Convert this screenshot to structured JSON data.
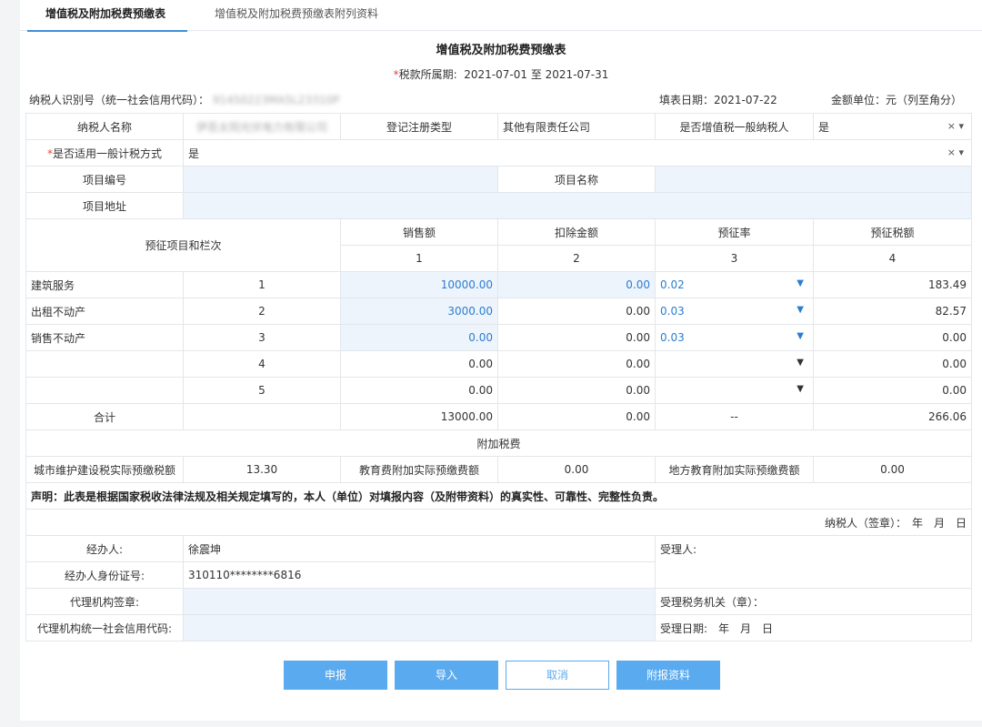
{
  "tabs": [
    "增值税及附加税费预缴表",
    "增值税及附加税费预缴表附列资料"
  ],
  "form": {
    "title": "增值税及附加税费预缴表",
    "period_star": "*",
    "period_label": "税款所属期:",
    "period_value": "2021-07-01 至 2021-07-31",
    "taxpayer_id_label": "纳税人识别号（统一社会信用代码）：",
    "taxpayer_id_value": "91450223MA5L23310P",
    "fill_date": "填表日期：2021-07-22",
    "amount_unit": "金额单位：元（列至角分）"
  },
  "info": {
    "name_label": "纳税人名称",
    "name_value": "伊吾太阳光伏电力有限公司",
    "reg_type_label": "登记注册类型",
    "reg_type_value": "其他有限责任公司",
    "general_label": "是否增值税一般纳税人",
    "general_value": "是",
    "method_label": "是否适用一般计税方式",
    "method_value": "是",
    "clear_icon": "×",
    "dropdown_icon": "▾",
    "proj_no_label": "项目编号",
    "proj_no_value": "",
    "proj_name_label": "项目名称",
    "proj_name_value": "",
    "proj_addr_label": "项目地址",
    "proj_addr_value": ""
  },
  "table": {
    "header_item": "预征项目和栏次",
    "col_headers": [
      "销售额",
      "扣除金额",
      "预征率",
      "预征税额"
    ],
    "col_numbers": [
      "1",
      "2",
      "3",
      "4"
    ],
    "rows": [
      {
        "item": "建筑服务",
        "no": "1",
        "sales": "10000.00",
        "deduct": "0.00",
        "rate": "0.02",
        "tax": "183.49"
      },
      {
        "item": "出租不动产",
        "no": "2",
        "sales": "3000.00",
        "deduct": "0.00",
        "rate": "0.03",
        "tax": "82.57"
      },
      {
        "item": "销售不动产",
        "no": "3",
        "sales": "0.00",
        "deduct": "0.00",
        "rate": "0.03",
        "tax": "0.00"
      },
      {
        "item": "",
        "no": "4",
        "sales": "0.00",
        "deduct": "0.00",
        "rate": "",
        "tax": "0.00"
      },
      {
        "item": "",
        "no": "5",
        "sales": "0.00",
        "deduct": "0.00",
        "rate": "",
        "tax": "0.00"
      }
    ],
    "total_label": "合计",
    "total_sales": "13000.00",
    "total_deduct": "0.00",
    "total_rate": "--",
    "total_tax": "266.06"
  },
  "surcharge": {
    "title": "附加税费",
    "city_label": "城市维护建设税实际预缴税额",
    "city_value": "13.30",
    "edu_label": "教育费附加实际预缴费额",
    "edu_value": "0.00",
    "local_edu_label": "地方教育附加实际预缴费额",
    "local_edu_value": "0.00"
  },
  "declaration": "声明：此表是根据国家税收法律法规及相关规定填写的，本人（单位）对填报内容（及附带资料）的真实性、可靠性、完整性负责。",
  "signature": "纳税人（签章）：　年　月　日",
  "agent": {
    "handler_label": "经办人:",
    "handler_value": "徐震坤",
    "id_label": "经办人身份证号:",
    "id_value": "310110********6816",
    "agency_seal_label": "代理机构签章:",
    "agency_code_label": "代理机构统一社会信用代码:",
    "receiver_label": "受理人:",
    "tax_office_label": "受理税务机关（章）：",
    "accept_date_label": "受理日期:　年　月　日"
  },
  "buttons": {
    "submit": "申报",
    "import": "导入",
    "cancel": "取消",
    "attach": "附报资料"
  }
}
